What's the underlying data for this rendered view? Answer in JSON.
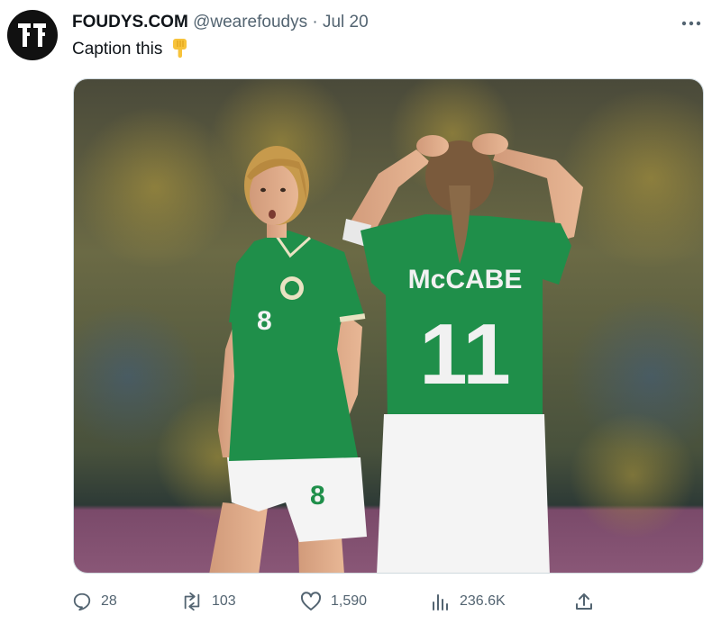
{
  "tweet": {
    "author_name": "FOUDYS.COM",
    "handle": "@wearefoudys",
    "separator": "·",
    "date": "Jul 20",
    "text": "Caption this",
    "emoji": "backhand-index-pointing-down",
    "media": {
      "player_left_number": "8",
      "player_right_name": "McCABE",
      "player_right_number": "11"
    }
  },
  "actions": {
    "replies": "28",
    "reposts": "103",
    "likes": "1,590",
    "views": "236.6K"
  },
  "colors": {
    "jersey_green": "#1f8f4a",
    "text_primary": "#0f1419",
    "text_secondary": "#536471"
  },
  "icons": [
    "ff-logo",
    "more-icon",
    "reply-icon",
    "repost-icon",
    "like-icon",
    "views-icon",
    "share-icon"
  ]
}
